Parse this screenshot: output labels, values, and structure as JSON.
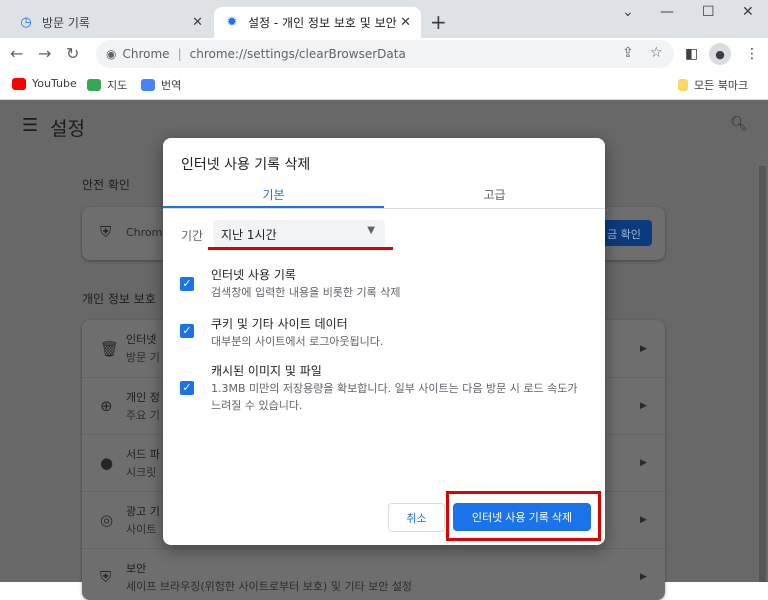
{
  "tabs": [
    {
      "label": "방문 기록",
      "icon": "history-icon"
    },
    {
      "label": "설정 - 개인 정보 보호 및 보안",
      "icon": "gear-icon"
    }
  ],
  "omnibox": {
    "site": "Chrome",
    "url": "chrome://settings/clearBrowserData"
  },
  "bookmarks": [
    {
      "label": "YouTube"
    },
    {
      "label": "지도"
    },
    {
      "label": "번역"
    }
  ],
  "all_bookmarks": "모든 북마크",
  "settings": {
    "title": "설정",
    "safety_section": "안전 확인",
    "safety_text": "Chrom",
    "safety_button": "금 확인",
    "privacy_section": "개인 정보 보호",
    "rows": [
      {
        "title": "인터넷",
        "sub": "방문 기"
      },
      {
        "title": "개인 정",
        "sub": "주요 기"
      },
      {
        "title": "서드 파",
        "sub": "시크릿"
      },
      {
        "title": "광고 기",
        "sub": "사이트"
      },
      {
        "title": "보안",
        "sub": "세이프 브라우징(위험한 사이트로부터 보호) 및 기타 보안 설정"
      }
    ]
  },
  "dialog": {
    "title": "인터넷 사용 기록 삭제",
    "tabs": [
      "기본",
      "고급"
    ],
    "period_label": "기간",
    "period_value": "지난 1시간",
    "options": [
      {
        "title": "인터넷 사용 기록",
        "sub": "검색창에 입력한 내용을 비롯한 기록 삭제",
        "checked": true
      },
      {
        "title": "쿠키 및 기타 사이트 데이터",
        "sub": "대부분의 사이트에서 로그아웃됩니다.",
        "checked": true
      },
      {
        "title": "캐시된 이미지 및 파일",
        "sub": "1.3MB 미만의 저장용량을 확보합니다. 일부 사이트는 다음 방문 시 로드 속도가 느려질 수 있습니다.",
        "checked": true
      }
    ],
    "cancel": "취소",
    "confirm": "인터넷 사용 기록 삭제"
  },
  "colors": {
    "accent": "#1a73e8",
    "highlight": "#e00000"
  }
}
